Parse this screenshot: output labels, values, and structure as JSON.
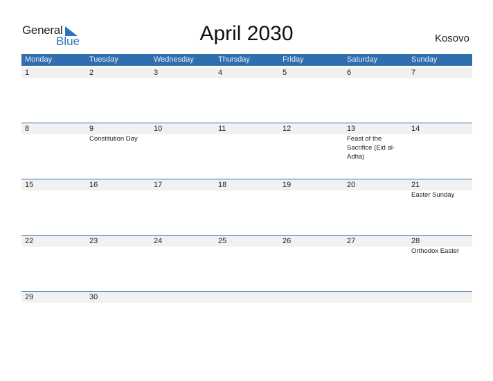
{
  "logo": {
    "general": "General",
    "blue": "Blue"
  },
  "title": "April 2030",
  "country": "Kosovo",
  "weekdays": [
    "Monday",
    "Tuesday",
    "Wednesday",
    "Thursday",
    "Friday",
    "Saturday",
    "Sunday"
  ],
  "weeks": [
    [
      {
        "day": "1",
        "holiday": ""
      },
      {
        "day": "2",
        "holiday": ""
      },
      {
        "day": "3",
        "holiday": ""
      },
      {
        "day": "4",
        "holiday": ""
      },
      {
        "day": "5",
        "holiday": ""
      },
      {
        "day": "6",
        "holiday": ""
      },
      {
        "day": "7",
        "holiday": ""
      }
    ],
    [
      {
        "day": "8",
        "holiday": ""
      },
      {
        "day": "9",
        "holiday": "Constitution Day"
      },
      {
        "day": "10",
        "holiday": ""
      },
      {
        "day": "11",
        "holiday": ""
      },
      {
        "day": "12",
        "holiday": ""
      },
      {
        "day": "13",
        "holiday": "Feast of the Sacrifice (Eid al-Adha)"
      },
      {
        "day": "14",
        "holiday": ""
      }
    ],
    [
      {
        "day": "15",
        "holiday": ""
      },
      {
        "day": "16",
        "holiday": ""
      },
      {
        "day": "17",
        "holiday": ""
      },
      {
        "day": "18",
        "holiday": ""
      },
      {
        "day": "19",
        "holiday": ""
      },
      {
        "day": "20",
        "holiday": ""
      },
      {
        "day": "21",
        "holiday": "Easter Sunday"
      }
    ],
    [
      {
        "day": "22",
        "holiday": ""
      },
      {
        "day": "23",
        "holiday": ""
      },
      {
        "day": "24",
        "holiday": ""
      },
      {
        "day": "25",
        "holiday": ""
      },
      {
        "day": "26",
        "holiday": ""
      },
      {
        "day": "27",
        "holiday": ""
      },
      {
        "day": "28",
        "holiday": "Orthodox Easter"
      }
    ],
    [
      {
        "day": "29",
        "holiday": ""
      },
      {
        "day": "30",
        "holiday": ""
      },
      {
        "day": "",
        "holiday": ""
      },
      {
        "day": "",
        "holiday": ""
      },
      {
        "day": "",
        "holiday": ""
      },
      {
        "day": "",
        "holiday": ""
      },
      {
        "day": "",
        "holiday": ""
      }
    ]
  ]
}
